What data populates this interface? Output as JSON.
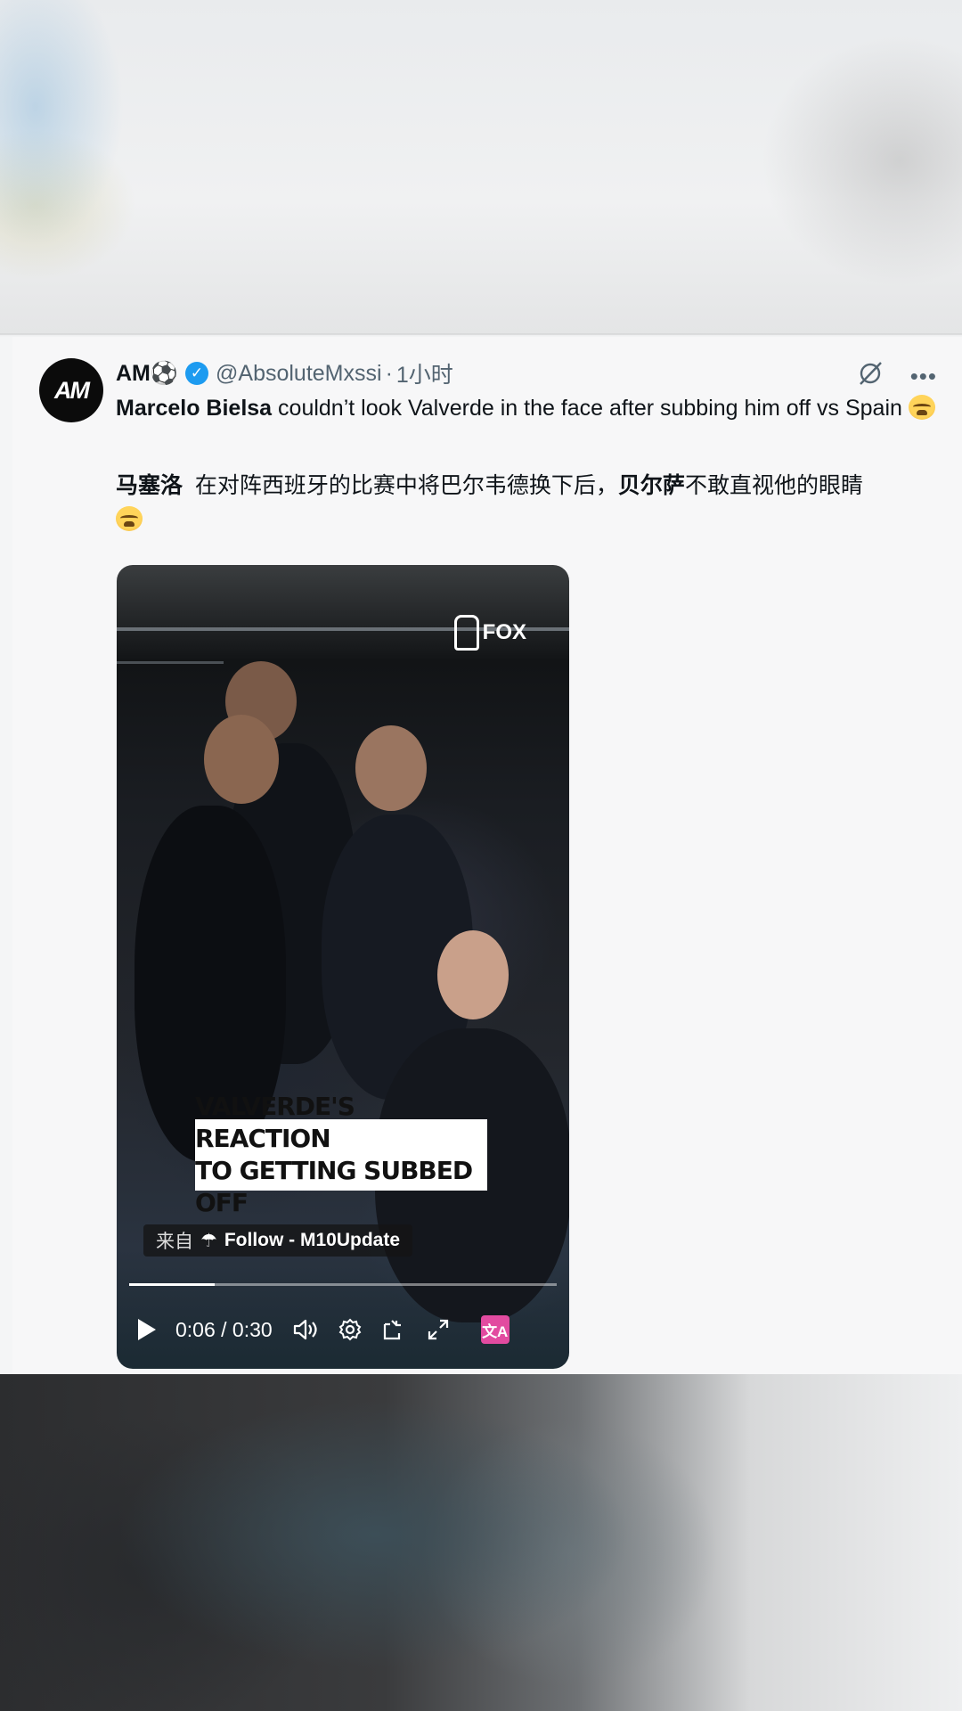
{
  "tweet": {
    "avatar_text": "AM",
    "display_name": "AM⚽",
    "handle": "@AbsoluteMxssi",
    "separator": "·",
    "time": "1小时",
    "text_en_bold": "Marcelo Bielsa",
    "text_en_rest": " couldn’t look Valverde in the face after subbing him off vs Spain",
    "text_zh_bold1": "马塞洛",
    "text_zh_mid": "  在对阵西班牙的比赛中将巴尔韦德换下后，",
    "text_zh_bold2": "贝尔萨",
    "text_zh_rest": "不敢直视他的眼睛"
  },
  "video": {
    "broadcaster": "FOX",
    "caption_line1": "VALVERDE'S REACTION",
    "caption_line2": "TO GETTING SUBBED OFF",
    "source_prefix": "来自",
    "source_label": "Follow - M10Update",
    "timecode": "0:06 / 0:30",
    "progress": 0.2,
    "translate_icon_text": "文A"
  },
  "icons": {
    "verified": "verified-badge-icon",
    "grok": "grok-icon",
    "more": "more-icon",
    "play": "play-icon",
    "volume": "volume-icon",
    "settings": "settings-icon",
    "pip": "picture-in-picture-icon",
    "fullscreen": "fullscreen-icon",
    "translate": "translate-icon"
  },
  "colors": {
    "verified": "#1d9bf0",
    "secondary_text": "#536471",
    "translate_button": "#e24ba0"
  }
}
